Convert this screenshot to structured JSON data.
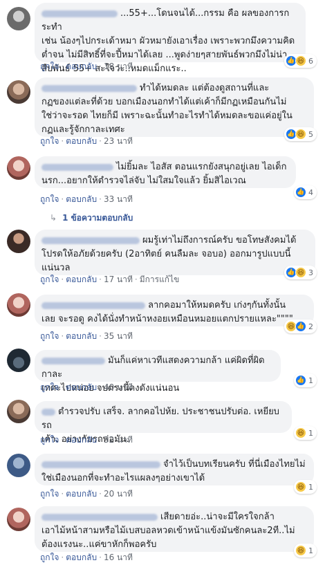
{
  "labels": {
    "like": "ถูกใจ",
    "reply": "ตอบกลับ",
    "edited": "มีการแก้ไข"
  },
  "comments": [
    {
      "lines": [
        "...55+...โดนจนได้...กรรม คือ ผลของการกระทำ",
        "เช่น น้องๆไปกระเด้าหมา ผัวหมายังเอาเรื่อง เพราะพวกมึงความคิด",
        "ต่ำจน ไม่มีสิทธิ์ที่จะปี้หมาได้เลย ...พูดง่ายๆสายพันธ์พวกมึงไม่น่า",
        "สืบพันธ์ 55+ สะใจว่ะ..หมดแม็กแระ.."
      ],
      "time": "18 นาที",
      "reactions": [
        "like",
        "haha"
      ],
      "count": "6"
    },
    {
      "lines": [
        "ทำได้หมดละ แต่ต้องดูสถานที่และ",
        "กฏของแต่ละที่ด้วย บอกเมืองนอกทำได้แต่เค้าก็มีกฏเหมือนกันไม่",
        "ใช่ว่าจะรอด ไทยก็มี เพราะฉะนั้นทำอะไรทำได้หมดละขอแค่อยู่ใน",
        "กฏและรู้จักกาละเทศะ"
      ],
      "time": "23 นาที",
      "reactions": [
        "like",
        "haha"
      ],
      "count": "5"
    },
    {
      "lines": [
        "ไม่ยิ้มละ ไอสัส ตอนแรกยังสนุกอยู่เลย ไอเด็ก",
        "นรก...อยากให้ตำรวจไล่จับ ไม่ใสมใจแล้ว ยิ้มสิไอเวณ"
      ],
      "time": "33 นาที",
      "reactions": [
        "like"
      ],
      "count": "4",
      "replies": "1 ข้อความตอบกลับ"
    },
    {
      "lines": [
        "ผมรู้เท่าไม่ถึงการณ์ครับ ขอโทษสังคมได้",
        "โปรดให้อภัยด้วยครับ (2อาทิตย์ คนลืมละ จอบอ) ออกมารูปแบบนี้",
        "แน่นวล"
      ],
      "time": "17 นาที",
      "edited": true,
      "reactions": [
        "like",
        "haha"
      ],
      "count": "3"
    },
    {
      "lines": [
        "ลากคอมาให้หมดครับ เก่งๆกันทั้งนั้น",
        "เลย จะรอดู คงได้นั่งทำหน้าหงอยเหมือนหมอยแตกปรายแหละ\"\"\"\""
      ],
      "time": "35 นาที",
      "reactions": [
        "haha",
        "like"
      ],
      "count": "2"
    },
    {
      "lines": [
        "มันก็แค่หาเวทีแสดงความกล้า แค่ผิดที่ผิดกาละ",
        "เทศะไปหน่อย จบตรงนี้คงดังแน่นอน"
      ],
      "time": "40 นาที",
      "reactions": [
        "like"
      ],
      "count": "1"
    },
    {
      "lines": [
        "ตำรวจปรับ เสร็จ. ลากคอไปห้ย. ประชาชนปรับต่อ. เหยียบรถ",
        "เค้า. อย่างกับรถพ่อมัน."
      ],
      "time": "32 นาที",
      "reactions": [
        "haha"
      ],
      "count": "1"
    },
    {
      "lines": [
        "จำไว้เป็นบทเรียนครับ ที่นี่เมืองไทยไม่",
        "ใช่เมืองนอกที่จะทำอะไรแผลงๆอย่างเขาได้"
      ],
      "time": "20 นาที",
      "reactions": [
        "haha"
      ],
      "count": "1"
    },
    {
      "lines": [
        "เสียดายอ่ะ..น่าจะมีใครใจกล้า",
        "เอาไม้หน้าสามหรือไม้เบสบอลหวดเข้าหน้าแข้งมันซักคนละ2ที..ไม่",
        "ต้องแรงนะ..แค่ขาหักก็พอครับ"
      ],
      "time": "16 นาที",
      "reactions": [
        "haha"
      ],
      "count": "1"
    }
  ]
}
